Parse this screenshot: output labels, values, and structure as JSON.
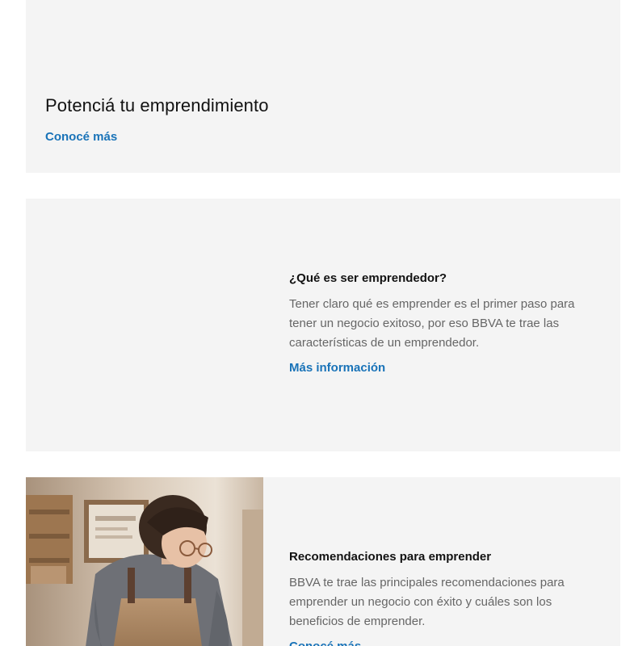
{
  "hero": {
    "title": "Potenciá tu emprendimiento",
    "link": "Conocé más"
  },
  "section_entrepreneur": {
    "title": "¿Qué es ser emprendedor?",
    "body": "Tener claro qué es emprender es el primer paso para tener un negocio exitoso, por eso BBVA te trae las características de un emprendedor.",
    "link": "Más información"
  },
  "section_recommendations": {
    "title": "Recomendaciones para emprender",
    "body": "BBVA te trae las principales recomendaciones para emprender un negocio con éxito y cuáles son los beneficios de emprender.",
    "link": "Conocé más"
  },
  "colors": {
    "card_background": "#f4f4f4",
    "link": "#1973b8",
    "title": "#121212",
    "body_text": "#666666"
  }
}
